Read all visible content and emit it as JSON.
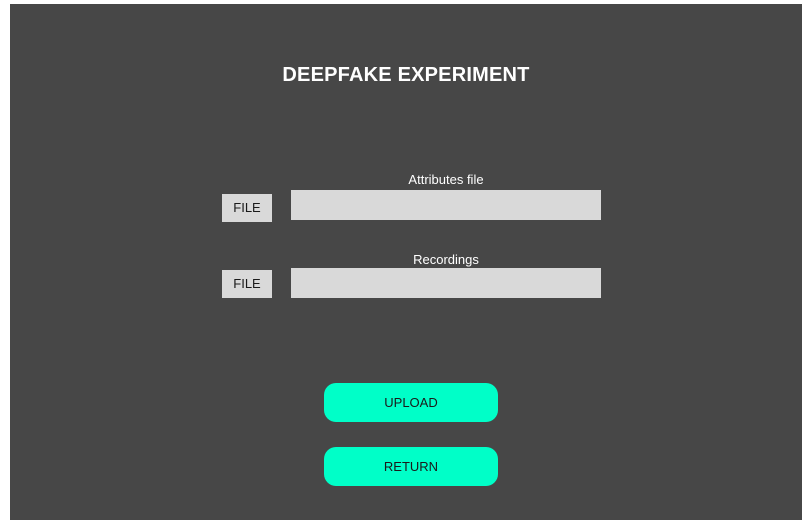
{
  "app": {
    "title": "DEEPFAKE EXPERIMENT"
  },
  "form": {
    "attributes": {
      "label": "Attributes file",
      "file_button": "FILE",
      "value": ""
    },
    "recordings": {
      "label": "Recordings",
      "file_button": "FILE",
      "value": ""
    }
  },
  "actions": {
    "upload_label": "UPLOAD",
    "return_label": "RETURN"
  },
  "colors": {
    "background": "#474747",
    "field": "#d9d9d9",
    "accent": "#00ffc8"
  }
}
